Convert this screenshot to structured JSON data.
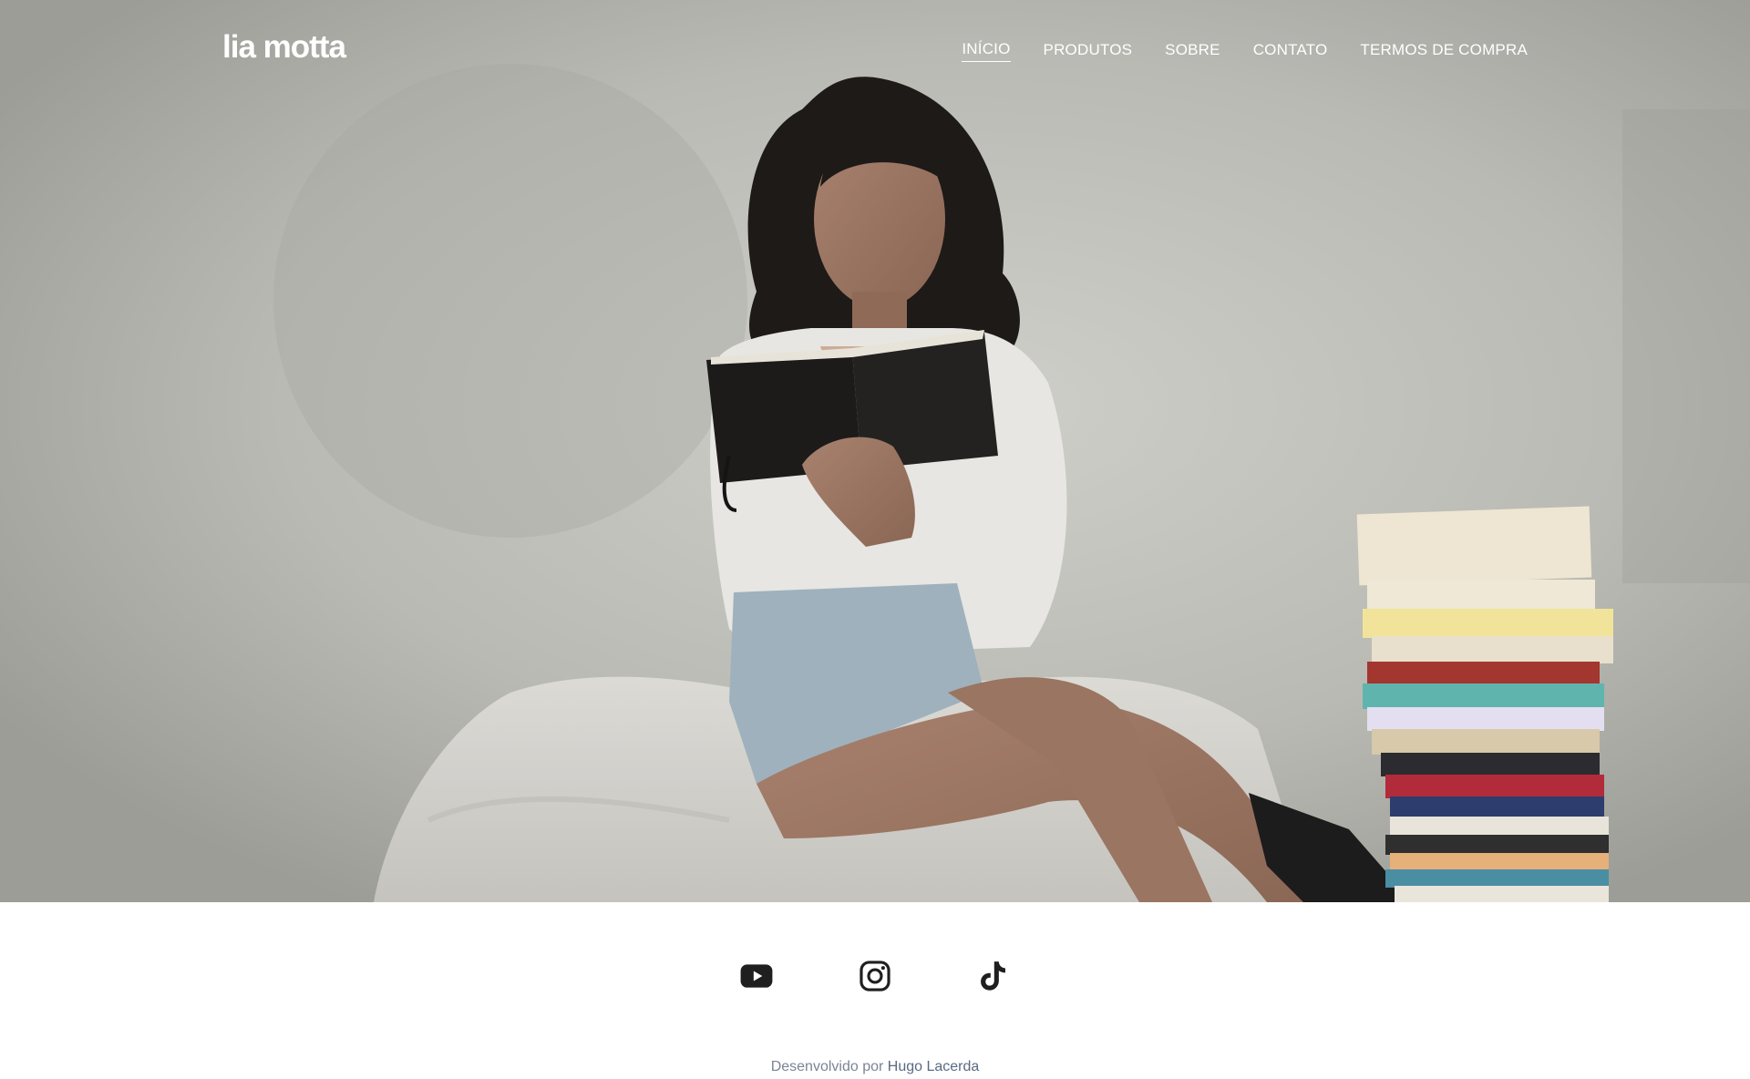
{
  "header": {
    "logo": "lia motta",
    "nav": [
      {
        "label": "INÍCIO",
        "active": true
      },
      {
        "label": "PRODUTOS",
        "active": false
      },
      {
        "label": "SOBRE",
        "active": false
      },
      {
        "label": "CONTATO",
        "active": false
      },
      {
        "label": "TERMOS DE COMPRA",
        "active": false
      }
    ]
  },
  "hero": {
    "image": "woman-reading-book-icon"
  },
  "social": [
    {
      "icon": "youtube-icon"
    },
    {
      "icon": "instagram-icon"
    },
    {
      "icon": "tiktok-icon"
    }
  ],
  "footer": {
    "prefix": "Desenvolvido por",
    "author": "Hugo Lacerda"
  },
  "colors": {
    "nav_text": "#ffffff",
    "icon": "#1f1f1f",
    "footer_text": "#7a8596",
    "footer_link": "#5a6a82"
  }
}
